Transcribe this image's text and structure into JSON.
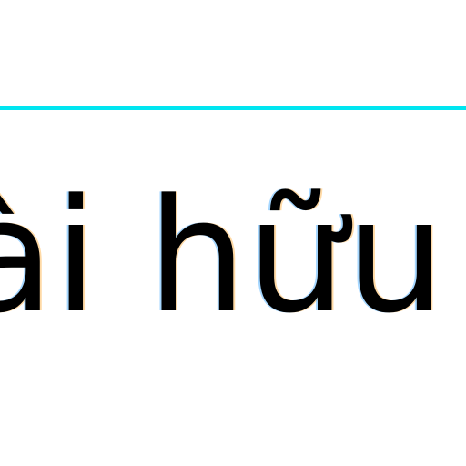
{
  "colors": {
    "accent_rule": "#00e5f0",
    "text": "#000000",
    "background": "#ffffff"
  },
  "content": {
    "visible_text": "ài hữu c"
  }
}
